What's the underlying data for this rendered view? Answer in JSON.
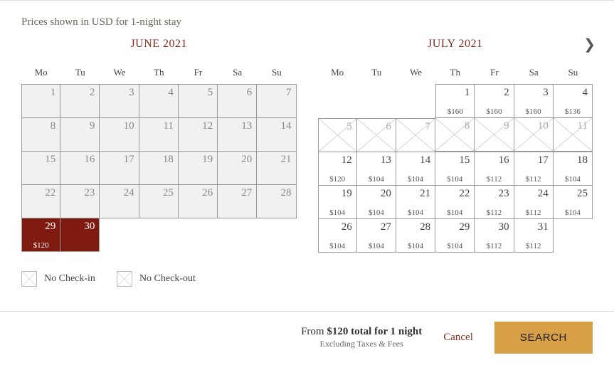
{
  "priceNote": "Prices shown in USD for 1-night stay",
  "dow": [
    "Mo",
    "Tu",
    "We",
    "Th",
    "Fr",
    "Sa",
    "Su"
  ],
  "months": [
    {
      "title": "JUNE 2021",
      "leading": 0,
      "days": [
        {
          "n": "1",
          "kind": "disabled"
        },
        {
          "n": "2",
          "kind": "disabled"
        },
        {
          "n": "3",
          "kind": "disabled"
        },
        {
          "n": "4",
          "kind": "disabled"
        },
        {
          "n": "5",
          "kind": "disabled"
        },
        {
          "n": "6",
          "kind": "disabled"
        },
        {
          "n": "7",
          "kind": "disabled"
        },
        {
          "n": "8",
          "kind": "disabled"
        },
        {
          "n": "9",
          "kind": "disabled"
        },
        {
          "n": "10",
          "kind": "disabled"
        },
        {
          "n": "11",
          "kind": "disabled"
        },
        {
          "n": "12",
          "kind": "disabled"
        },
        {
          "n": "13",
          "kind": "disabled"
        },
        {
          "n": "14",
          "kind": "disabled"
        },
        {
          "n": "15",
          "kind": "disabled"
        },
        {
          "n": "16",
          "kind": "disabled"
        },
        {
          "n": "17",
          "kind": "disabled"
        },
        {
          "n": "18",
          "kind": "disabled"
        },
        {
          "n": "19",
          "kind": "disabled"
        },
        {
          "n": "20",
          "kind": "disabled"
        },
        {
          "n": "21",
          "kind": "disabled"
        },
        {
          "n": "22",
          "kind": "disabled"
        },
        {
          "n": "23",
          "kind": "disabled"
        },
        {
          "n": "24",
          "kind": "disabled"
        },
        {
          "n": "25",
          "kind": "disabled"
        },
        {
          "n": "26",
          "kind": "disabled"
        },
        {
          "n": "27",
          "kind": "disabled"
        },
        {
          "n": "28",
          "kind": "disabled"
        },
        {
          "n": "29",
          "kind": "selected",
          "price": "$120"
        },
        {
          "n": "30",
          "kind": "selected"
        }
      ]
    },
    {
      "title": "JULY 2021",
      "leading": 3,
      "days": [
        {
          "n": "1",
          "kind": "avail",
          "price": "$160"
        },
        {
          "n": "2",
          "kind": "avail",
          "price": "$160"
        },
        {
          "n": "3",
          "kind": "avail",
          "price": "$160"
        },
        {
          "n": "4",
          "kind": "avail",
          "price": "$136"
        },
        {
          "n": "5",
          "kind": "crossed"
        },
        {
          "n": "6",
          "kind": "crossed"
        },
        {
          "n": "7",
          "kind": "crossed"
        },
        {
          "n": "8",
          "kind": "crossed"
        },
        {
          "n": "9",
          "kind": "crossed"
        },
        {
          "n": "10",
          "kind": "crossed"
        },
        {
          "n": "11",
          "kind": "crossed"
        },
        {
          "n": "12",
          "kind": "avail",
          "price": "$120"
        },
        {
          "n": "13",
          "kind": "avail",
          "price": "$104"
        },
        {
          "n": "14",
          "kind": "avail",
          "price": "$104"
        },
        {
          "n": "15",
          "kind": "avail",
          "price": "$104"
        },
        {
          "n": "16",
          "kind": "avail",
          "price": "$112"
        },
        {
          "n": "17",
          "kind": "avail",
          "price": "$112"
        },
        {
          "n": "18",
          "kind": "avail",
          "price": "$104"
        },
        {
          "n": "19",
          "kind": "avail",
          "price": "$104"
        },
        {
          "n": "20",
          "kind": "avail",
          "price": "$104"
        },
        {
          "n": "21",
          "kind": "avail",
          "price": "$104"
        },
        {
          "n": "22",
          "kind": "avail",
          "price": "$104"
        },
        {
          "n": "23",
          "kind": "avail",
          "price": "$112"
        },
        {
          "n": "24",
          "kind": "avail",
          "price": "$112"
        },
        {
          "n": "25",
          "kind": "avail",
          "price": "$104"
        },
        {
          "n": "26",
          "kind": "avail",
          "price": "$104"
        },
        {
          "n": "27",
          "kind": "avail",
          "price": "$104"
        },
        {
          "n": "28",
          "kind": "avail",
          "price": "$104"
        },
        {
          "n": "29",
          "kind": "avail",
          "price": "$104"
        },
        {
          "n": "30",
          "kind": "avail",
          "price": "$112"
        },
        {
          "n": "31",
          "kind": "avail",
          "price": "$112"
        }
      ]
    }
  ],
  "legend": {
    "noCheckin": "No Check-in",
    "noCheckout": "No Check-out"
  },
  "footer": {
    "from": "From ",
    "total": "$120 total for 1 night",
    "exclude": "Excluding Taxes & Fees",
    "cancel": "Cancel",
    "search": "SEARCH"
  }
}
